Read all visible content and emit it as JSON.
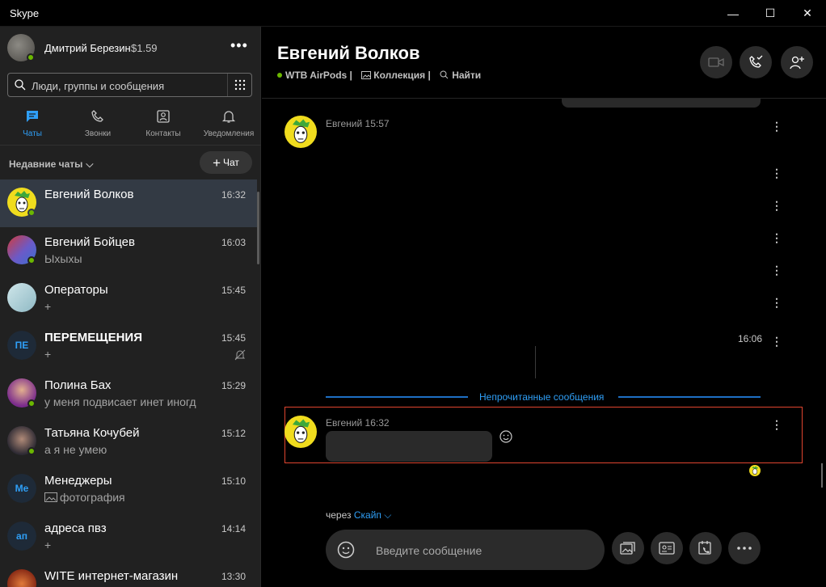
{
  "window": {
    "title": "Skype",
    "min": "—",
    "max": "☐",
    "close": "✕"
  },
  "profile": {
    "name": "Дмитрий Березин",
    "balance": "$1.59",
    "more": "•••"
  },
  "search": {
    "placeholder": "Люди, группы и сообщения"
  },
  "tabs": [
    {
      "label": "Чаты",
      "icon": "chat-icon",
      "active": true
    },
    {
      "label": "Звонки",
      "icon": "phone-icon"
    },
    {
      "label": "Контакты",
      "icon": "contacts-icon"
    },
    {
      "label": "Уведомления",
      "icon": "bell-icon"
    }
  ],
  "recent": {
    "label": "Недавние чаты",
    "new_chat": "Чат"
  },
  "chats": [
    {
      "name": "Евгений Волков",
      "preview": "",
      "time": "16:32",
      "online": true
    },
    {
      "name": "Евгений Бойцев",
      "preview": "Ыхыхы",
      "time": "16:03",
      "online": true
    },
    {
      "name": "Операторы",
      "preview": "+",
      "time": "15:45"
    },
    {
      "name": "ПЕРЕМЕЩЕНИЯ",
      "preview": "+",
      "time": "15:45",
      "initials": "ПЕ",
      "muted": true
    },
    {
      "name": "Полина Бах",
      "preview": "у меня подвисает инет иногд",
      "time": "15:29",
      "online": true
    },
    {
      "name": "Татьяна Кочубей",
      "preview": "а я не умею",
      "time": "15:12",
      "online": true
    },
    {
      "name": "Менеджеры",
      "preview": "фотография",
      "time": "15:10",
      "initials": "Ме"
    },
    {
      "name": "адреса пвз",
      "preview": "+",
      "time": "14:14",
      "initials": "ап"
    },
    {
      "name": "WITE интернет-магазин",
      "preview": "",
      "time": "13:30"
    }
  ],
  "conversation": {
    "name": "Евгений Волков",
    "sub": [
      "WTB AirPods |",
      "Коллекция |",
      "Найти"
    ],
    "msg1_meta": "Евгений 15:57",
    "time_right": "16:06",
    "unread_label": "Непрочитанные сообщения",
    "msg2_meta": "Евгений 16:32",
    "via_prefix": "через",
    "via_link": "Скайп"
  },
  "composer": {
    "placeholder": "Введите сообщение"
  },
  "colors": {
    "accent": "#2f9ff7",
    "online": "#6bb700",
    "highlight": "#e0452f"
  }
}
